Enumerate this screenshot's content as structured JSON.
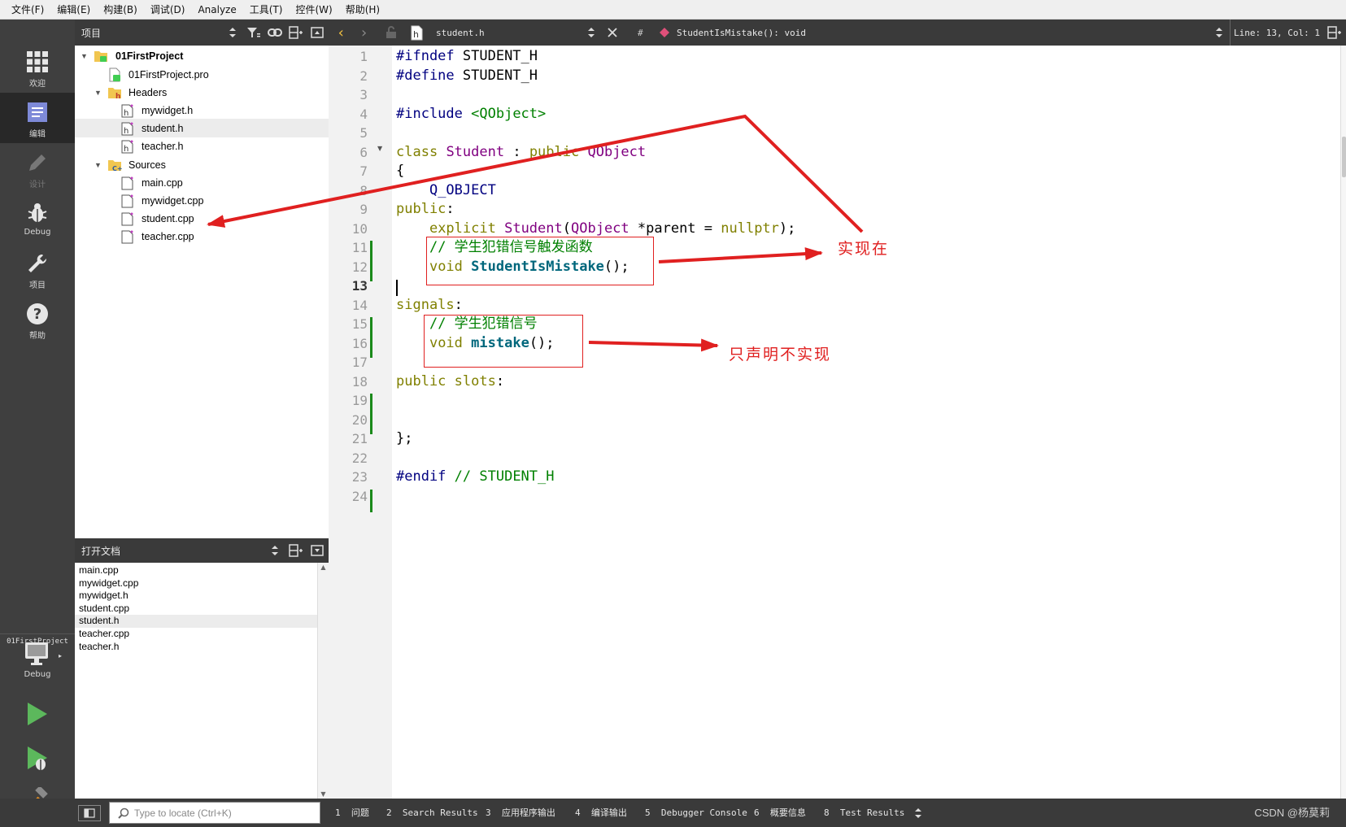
{
  "menu": [
    "文件(F)",
    "编辑(E)",
    "构建(B)",
    "调试(D)",
    "Analyze",
    "工具(T)",
    "控件(W)",
    "帮助(H)"
  ],
  "modes": [
    {
      "label": "欢迎",
      "icon": "grid-icon"
    },
    {
      "label": "编辑",
      "icon": "edit-doc-icon"
    },
    {
      "label": "设计",
      "icon": "pencil-icon"
    },
    {
      "label": "Debug",
      "icon": "bug-icon"
    },
    {
      "label": "项目",
      "icon": "wrench-icon"
    },
    {
      "label": "帮助",
      "icon": "help-icon"
    }
  ],
  "kit": {
    "project": "01FirstProject",
    "config": "Debug"
  },
  "project_panel": {
    "title": "项目",
    "tree": [
      {
        "label": "01FirstProject",
        "level": 0,
        "expanded": true,
        "icon": "qt-project-icon",
        "bold": true
      },
      {
        "label": "01FirstProject.pro",
        "level": 1,
        "icon": "qt-pro-file-icon"
      },
      {
        "label": "Headers",
        "level": 1,
        "expanded": true,
        "icon": "header-folder-icon"
      },
      {
        "label": "mywidget.h",
        "level": 2,
        "icon": "header-file-icon"
      },
      {
        "label": "student.h",
        "level": 2,
        "icon": "header-file-icon",
        "selected": true
      },
      {
        "label": "teacher.h",
        "level": 2,
        "icon": "header-file-icon"
      },
      {
        "label": "Sources",
        "level": 1,
        "expanded": true,
        "icon": "source-folder-icon"
      },
      {
        "label": "main.cpp",
        "level": 2,
        "icon": "cpp-file-icon"
      },
      {
        "label": "mywidget.cpp",
        "level": 2,
        "icon": "cpp-file-icon"
      },
      {
        "label": "student.cpp",
        "level": 2,
        "icon": "cpp-file-icon"
      },
      {
        "label": "teacher.cpp",
        "level": 2,
        "icon": "cpp-file-icon"
      }
    ]
  },
  "open_docs": {
    "title": "打开文档",
    "items": [
      "main.cpp",
      "mywidget.cpp",
      "mywidget.h",
      "student.cpp",
      "student.h",
      "teacher.cpp",
      "teacher.h"
    ],
    "selected": "student.h"
  },
  "editor_toolbar": {
    "filename": "student.h",
    "hash": "#",
    "symbol": "StudentIsMistake(): void",
    "position": "Line: 13, Col: 1"
  },
  "code_lines": [
    [
      [
        "pp",
        "#ifndef"
      ],
      [
        "",
        " STUDENT_H"
      ]
    ],
    [
      [
        "pp",
        "#define"
      ],
      [
        "",
        " STUDENT_H"
      ]
    ],
    [],
    [
      [
        "pp",
        "#include"
      ],
      [
        "",
        " "
      ],
      [
        "cm",
        "<QObject>"
      ]
    ],
    [],
    [
      [
        "kw",
        "class"
      ],
      [
        "",
        " "
      ],
      [
        "ty",
        "Student"
      ],
      [
        "",
        " : "
      ],
      [
        "kw",
        "public"
      ],
      [
        "",
        " "
      ],
      [
        "ty",
        "QObject"
      ]
    ],
    [
      [
        "",
        "{"
      ]
    ],
    [
      [
        "",
        "    "
      ],
      [
        "mac",
        "Q_OBJECT"
      ]
    ],
    [
      [
        "kw",
        "public"
      ],
      [
        "",
        ":"
      ]
    ],
    [
      [
        "",
        "    "
      ],
      [
        "kw",
        "explicit"
      ],
      [
        "",
        " "
      ],
      [
        "ty",
        "Student"
      ],
      [
        "",
        "("
      ],
      [
        "ty",
        "QObject"
      ],
      [
        "",
        " *parent = "
      ],
      [
        "kw",
        "nullptr"
      ],
      [
        "",
        ");"
      ]
    ],
    [
      [
        "",
        "    "
      ],
      [
        "cm",
        "// 学生犯错信号触发函数"
      ]
    ],
    [
      [
        "",
        "    "
      ],
      [
        "kw",
        "void"
      ],
      [
        "",
        " "
      ],
      [
        "fn",
        "StudentIsMistake"
      ],
      [
        "",
        "();"
      ]
    ],
    [],
    [
      [
        "kw",
        "signals"
      ],
      [
        "",
        ":"
      ]
    ],
    [
      [
        "",
        "    "
      ],
      [
        "cm",
        "// 学生犯错信号"
      ]
    ],
    [
      [
        "",
        "    "
      ],
      [
        "kw",
        "void"
      ],
      [
        "",
        " "
      ],
      [
        "fn",
        "mistake"
      ],
      [
        "",
        "();"
      ]
    ],
    [],
    [
      [
        "kw",
        "public slots"
      ],
      [
        "",
        ":"
      ]
    ],
    [],
    [],
    [
      [
        "",
        "};"
      ]
    ],
    [],
    [
      [
        "pp",
        "#endif"
      ],
      [
        "",
        " "
      ],
      [
        "cm",
        "// STUDENT_H"
      ]
    ],
    []
  ],
  "line_numbers": [
    "1",
    "2",
    "3",
    "4",
    "5",
    "6",
    "7",
    "8",
    "9",
    "10",
    "11",
    "12",
    "13",
    "14",
    "15",
    "16",
    "17",
    "18",
    "19",
    "20",
    "21",
    "22",
    "23",
    "24"
  ],
  "current_line": 13,
  "annotations": {
    "implement_at": "实现在",
    "declare_only": "只声明不实现"
  },
  "locator": {
    "placeholder": "Type to locate (Ctrl+K)"
  },
  "output_panes": [
    {
      "num": "1",
      "label": "问题"
    },
    {
      "num": "2",
      "label": "Search Results"
    },
    {
      "num": "3",
      "label": "应用程序输出"
    },
    {
      "num": "4",
      "label": "编译输出"
    },
    {
      "num": "5",
      "label": "Debugger Console"
    },
    {
      "num": "6",
      "label": "概要信息"
    },
    {
      "num": "8",
      "label": "Test Results"
    }
  ],
  "watermark": "CSDN @杨莫莉",
  "colors": {
    "annotation": "#e02020",
    "modified_marker": "#1b8a1b",
    "sidebar": "#3f3f3f"
  }
}
